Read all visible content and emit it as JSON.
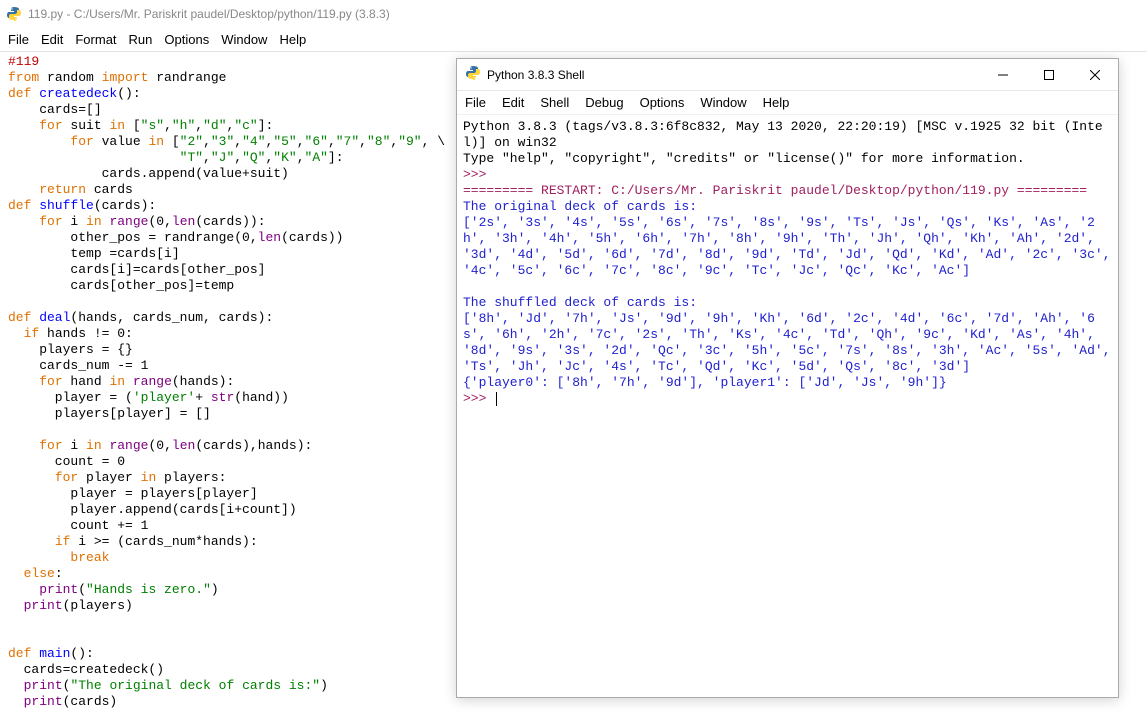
{
  "editor": {
    "title": "119.py - C:/Users/Mr. Pariskrit paudel/Desktop/python/119.py (3.8.3)",
    "menu": [
      "File",
      "Edit",
      "Format",
      "Run",
      "Options",
      "Window",
      "Help"
    ],
    "code": {
      "l1": "#119",
      "l2a": "from",
      "l2b": " random ",
      "l2c": "import",
      "l2d": " randrange",
      "l3a": "def",
      "l3b": " createdeck",
      "l3c": "():",
      "l4": "    cards=[]",
      "l5a": "    ",
      "l5b": "for",
      "l5c": " suit ",
      "l5d": "in",
      "l5e": " [",
      "l5f": "\"s\"",
      "l5g": ",",
      "l5h": "\"h\"",
      "l5i": ",",
      "l5j": "\"d\"",
      "l5k": ",",
      "l5l": "\"c\"",
      "l5m": "]:",
      "l6a": "        ",
      "l6b": "for",
      "l6c": " value ",
      "l6d": "in",
      "l6e": " [",
      "l6f": "\"2\"",
      "l6g": ",",
      "l6h": "\"3\"",
      "l6i": ",",
      "l6j": "\"4\"",
      "l6k": ",",
      "l6l": "\"5\"",
      "l6m": ",",
      "l6n": "\"6\"",
      "l6o": ",",
      "l6p": "\"7\"",
      "l6q": ",",
      "l6r": "\"8\"",
      "l6s": ",",
      "l6t": "\"9\"",
      "l6u": ", \\",
      "l7a": "                      ",
      "l7b": "\"T\"",
      "l7c": ",",
      "l7d": "\"J\"",
      "l7e": ",",
      "l7f": "\"Q\"",
      "l7g": ",",
      "l7h": "\"K\"",
      "l7i": ",",
      "l7j": "\"A\"",
      "l7k": "]:",
      "l8": "            cards.append(value+suit)",
      "l9a": "    ",
      "l9b": "return",
      "l9c": " cards",
      "l10a": "def",
      "l10b": " shuffle",
      "l10c": "(cards):",
      "l11a": "    ",
      "l11b": "for",
      "l11c": " i ",
      "l11d": "in",
      "l11e": " ",
      "l11f": "range",
      "l11g": "(",
      "l11h": "0",
      "l11i": ",",
      "l11j": "len",
      "l11k": "(cards)):",
      "l12a": "        other_pos = randrange(",
      "l12b": "0",
      "l12c": ",",
      "l12d": "len",
      "l12e": "(cards))",
      "l13": "        temp =cards[i]",
      "l14": "        cards[i]=cards[other_pos]",
      "l15": "        cards[other_pos]=temp",
      "l16a": "def",
      "l16b": " deal",
      "l16c": "(hands, cards_num, cards):",
      "l17a": "  ",
      "l17b": "if",
      "l17c": " hands != ",
      "l17d": "0",
      "l17e": ":",
      "l18": "    players = {}",
      "l19a": "    cards_num -= ",
      "l19b": "1",
      "l20a": "    ",
      "l20b": "for",
      "l20c": " hand ",
      "l20d": "in",
      "l20e": " ",
      "l20f": "range",
      "l20g": "(hands):",
      "l21a": "      player = (",
      "l21b": "'player'",
      "l21c": "+ ",
      "l21d": "str",
      "l21e": "(hand))",
      "l22": "      players[player] = []",
      "l23a": "    ",
      "l23b": "for",
      "l23c": " i ",
      "l23d": "in",
      "l23e": " ",
      "l23f": "range",
      "l23g": "(",
      "l23h": "0",
      "l23i": ",",
      "l23j": "len",
      "l23k": "(cards),hands):",
      "l24a": "      count = ",
      "l24b": "0",
      "l25a": "      ",
      "l25b": "for",
      "l25c": " player ",
      "l25d": "in",
      "l25e": " players:",
      "l26": "        player = players[player]",
      "l27": "        player.append(cards[i+count])",
      "l28a": "        count += ",
      "l28b": "1",
      "l29a": "      ",
      "l29b": "if",
      "l29c": " i >= (cards_num*hands):",
      "l30a": "        ",
      "l30b": "break",
      "l31a": "  ",
      "l31b": "else",
      "l31c": ":",
      "l32a": "    ",
      "l32b": "print",
      "l32c": "(",
      "l32d": "\"Hands is zero.\"",
      "l32e": ")",
      "l33a": "  ",
      "l33b": "print",
      "l33c": "(players)",
      "l34a": "def",
      "l34b": " main",
      "l34c": "():",
      "l35": "  cards=createdeck()",
      "l36a": "  ",
      "l36b": "print",
      "l36c": "(",
      "l36d": "\"The original deck of cards is:\"",
      "l36e": ")",
      "l37a": "  ",
      "l37b": "print",
      "l37c": "(cards)"
    }
  },
  "shell": {
    "title": "Python 3.8.3 Shell",
    "menu": [
      "File",
      "Edit",
      "Shell",
      "Debug",
      "Options",
      "Window",
      "Help"
    ],
    "banner1": "Python 3.8.3 (tags/v3.8.3:6f8c832, May 13 2020, 22:20:19) [MSC v.1925 32 bit (Intel)] on win32",
    "banner2": "Type \"help\", \"copyright\", \"credits\" or \"license()\" for more information.",
    "prompt": ">>> ",
    "restart": "========= RESTART: C:/Users/Mr. Pariskrit paudel/Desktop/python/119.py =========",
    "out1": "The original deck of cards is:",
    "out2": "['2s', '3s', '4s', '5s', '6s', '7s', '8s', '9s', 'Ts', 'Js', 'Qs', 'Ks', 'As', '2h', '3h', '4h', '5h', '6h', '7h', '8h', '9h', 'Th', 'Jh', 'Qh', 'Kh', 'Ah', '2d', '3d', '4d', '5d', '6d', '7d', '8d', '9d', 'Td', 'Jd', 'Qd', 'Kd', 'Ad', '2c', '3c', '4c', '5c', '6c', '7c', '8c', '9c', 'Tc', 'Jc', 'Qc', 'Kc', 'Ac']",
    "out3": "",
    "out4": "The shuffled deck of cards is:",
    "out5": "['8h', 'Jd', '7h', 'Js', '9d', '9h', 'Kh', '6d', '2c', '4d', '6c', '7d', 'Ah', '6s', '6h', '2h', '7c', '2s', 'Th', 'Ks', '4c', 'Td', 'Qh', '9c', 'Kd', 'As', '4h', '8d', '9s', '3s', '2d', 'Qc', '3c', '5h', '5c', '7s', '8s', '3h', 'Ac', '5s', 'Ad', 'Ts', 'Jh', 'Jc', '4s', 'Tc', 'Qd', 'Kc', '5d', 'Qs', '8c', '3d']",
    "out6": "{'player0': ['8h', '7h', '9d'], 'player1': ['Jd', 'Js', '9h']}"
  }
}
